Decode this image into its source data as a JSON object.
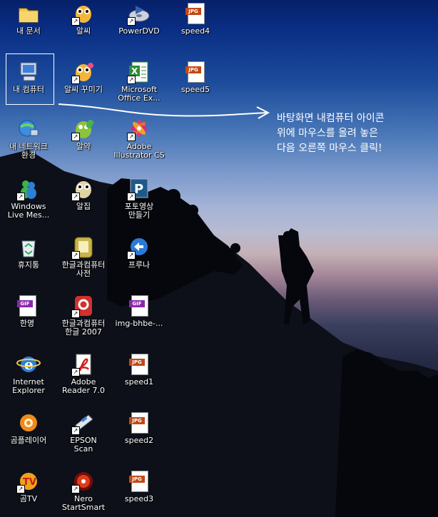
{
  "desktop": {
    "icons": [
      {
        "id": "my-documents",
        "label": "내 문서",
        "icon": "folder-icon"
      },
      {
        "id": "alssi",
        "label": "알씨",
        "icon": "alssi-icon"
      },
      {
        "id": "powerdvd",
        "label": "PowerDVD",
        "icon": "powerdvd-icon"
      },
      {
        "id": "speed4",
        "label": "speed4",
        "icon": "jpg-file-icon",
        "badge": "JPG"
      },
      {
        "id": "my-computer",
        "label": "내 컴퓨터",
        "icon": "my-computer-icon"
      },
      {
        "id": "alssi-kkumigi",
        "label": "알씨 꾸미기",
        "icon": "alssi-icon"
      },
      {
        "id": "ms-office-excel",
        "label": "Microsoft\nOffice Ex...",
        "icon": "excel-icon"
      },
      {
        "id": "speed5",
        "label": "speed5",
        "icon": "jpg-file-icon",
        "badge": "JPG"
      },
      {
        "id": "my-network",
        "label": "내 네트워크\n환경",
        "icon": "network-icon"
      },
      {
        "id": "alyak",
        "label": "알약",
        "icon": "alyak-icon"
      },
      {
        "id": "adobe-illustrator",
        "label": "Adobe\nIllustrator CS",
        "icon": "illustrator-icon"
      },
      {
        "id": "windows-live-messenger",
        "label": "Windows\nLive Mes...",
        "icon": "messenger-icon"
      },
      {
        "id": "aljip",
        "label": "알집",
        "icon": "aljip-icon"
      },
      {
        "id": "photo-video",
        "label": "포토영상\n만들기",
        "icon": "photo-video-icon"
      },
      {
        "id": "recycle-bin",
        "label": "휴지통",
        "icon": "recycle-bin-icon"
      },
      {
        "id": "hangul-dictionary",
        "label": "한글과컴퓨터\n사전",
        "icon": "dictionary-icon"
      },
      {
        "id": "pruna",
        "label": "프루나",
        "icon": "pruna-icon"
      },
      {
        "id": "hanmyeong",
        "label": "한명",
        "icon": "gif-file-icon",
        "badge": "GIF"
      },
      {
        "id": "hangul-2007",
        "label": "한글과컴퓨터\n한글 2007",
        "icon": "hangul-icon"
      },
      {
        "id": "img-bhbe",
        "label": "img-bhbe-...",
        "icon": "gif-file-icon",
        "badge": "GIF"
      },
      {
        "id": "internet-explorer",
        "label": "Internet\nExplorer",
        "icon": "ie-icon"
      },
      {
        "id": "adobe-reader",
        "label": "Adobe\nReader 7.0",
        "icon": "adobe-reader-icon"
      },
      {
        "id": "speed1",
        "label": "speed1",
        "icon": "jpg-file-icon",
        "badge": "JPG"
      },
      {
        "id": "gom-player",
        "label": "곰플레이어",
        "icon": "gom-player-icon"
      },
      {
        "id": "epson-scan",
        "label": "EPSON\nScan",
        "icon": "scanner-icon"
      },
      {
        "id": "speed2",
        "label": "speed2",
        "icon": "jpg-file-icon",
        "badge": "JPG"
      },
      {
        "id": "gom-tv",
        "label": "곰TV",
        "icon": "gom-tv-icon"
      },
      {
        "id": "nero",
        "label": "Nero\nStartSmart",
        "icon": "nero-icon"
      },
      {
        "id": "speed3",
        "label": "speed3",
        "icon": "jpg-file-icon",
        "badge": "JPG"
      }
    ],
    "annotation": "바탕화면 내컴퓨터 아이콘\n위에 마우스를 올려 놓은\n다음 오른쪽 마우스 클릭!",
    "shortcut_arrow": "↗",
    "colors": {
      "label_text": "#ffffff",
      "annotation_text": "#ffffff",
      "selection_border": "#ffffff"
    }
  }
}
